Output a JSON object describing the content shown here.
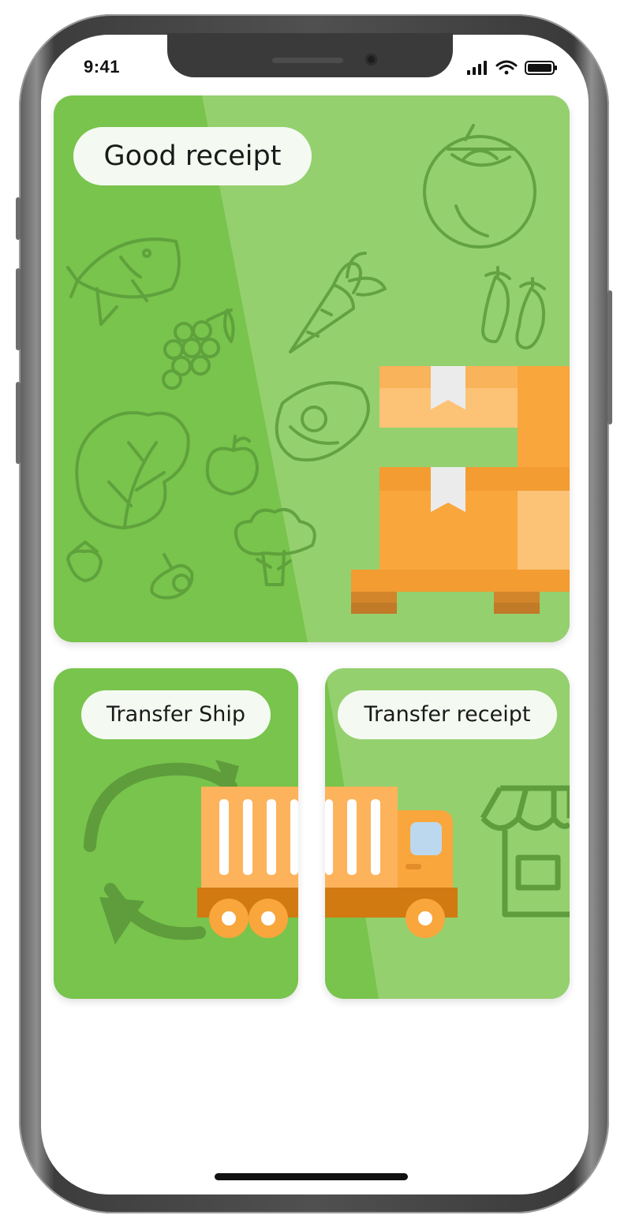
{
  "status_bar": {
    "time": "9:41",
    "icons": [
      "cellular-signal-icon",
      "wifi-icon",
      "battery-icon"
    ]
  },
  "tiles": {
    "good_receipt": {
      "label": "Good receipt",
      "illustration": "box-pallet-with-grocery-pattern"
    },
    "transfer_ship": {
      "label": "Transfer Ship",
      "illustration": "truck-with-refresh-arrows"
    },
    "transfer_receipt": {
      "label": "Transfer receipt",
      "illustration": "truck-with-store"
    }
  },
  "colors": {
    "tile_green": "#78c44c",
    "tile_light_green": "#95d06f",
    "box_orange": "#f9a63c",
    "pill_background": "#f4faf1"
  }
}
